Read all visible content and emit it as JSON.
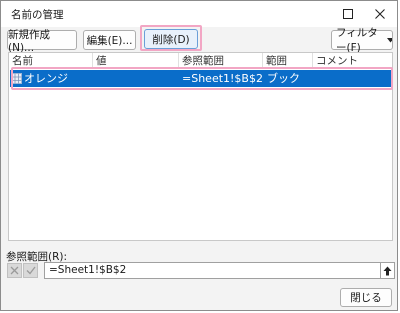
{
  "title": "名前の管理",
  "toolbar": {
    "new": "新規作成(N)...",
    "edit": "編集(E)...",
    "delete": "削除(D)",
    "filter": "フィルター(F)"
  },
  "table": {
    "headers": [
      "名前",
      "値",
      "参照範囲",
      "範囲",
      "コメント"
    ],
    "rows": [
      {
        "name": "オレンジ",
        "value": "",
        "ref": "=Sheet1!$B$2",
        "scope": "ブック",
        "comment": ""
      }
    ]
  },
  "ref_label": "参照範囲(R):",
  "ref_value": "=Sheet1!$B$2",
  "close": "閉じる",
  "colors": {
    "selection": "#0a6dc9",
    "highlight": "#f2a6c4"
  }
}
